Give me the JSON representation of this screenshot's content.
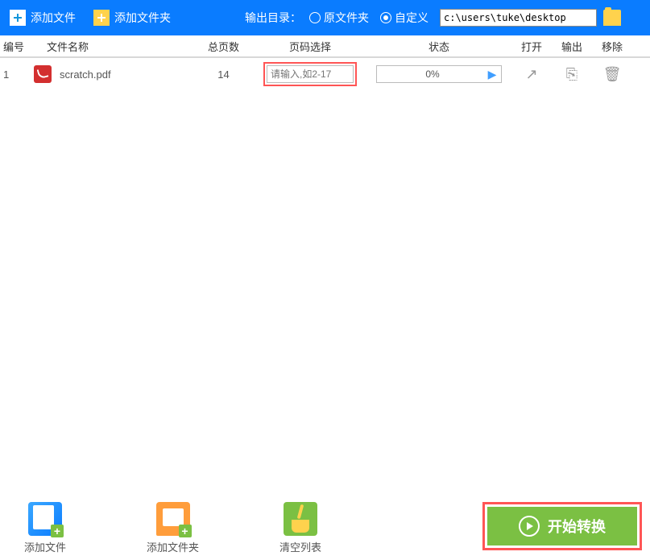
{
  "toolbar": {
    "add_file": "添加文件",
    "add_folder": "添加文件夹",
    "output_dir_label": "输出目录：",
    "radio_original": "原文件夹",
    "radio_custom": "自定义",
    "path_value": "c:\\users\\tuke\\desktop"
  },
  "headers": {
    "num": "编号",
    "name": "文件名称",
    "pages": "总页数",
    "sel": "页码选择",
    "status": "状态",
    "open": "打开",
    "output": "输出",
    "remove": "移除"
  },
  "rows": [
    {
      "num": "1",
      "name": "scratch.pdf",
      "pages": "14",
      "page_placeholder": "请输入,如2-17",
      "progress": "0%"
    }
  ],
  "bottom": {
    "add_file": "添加文件",
    "add_folder": "添加文件夹",
    "clear_list": "清空列表",
    "start": "开始转换"
  }
}
